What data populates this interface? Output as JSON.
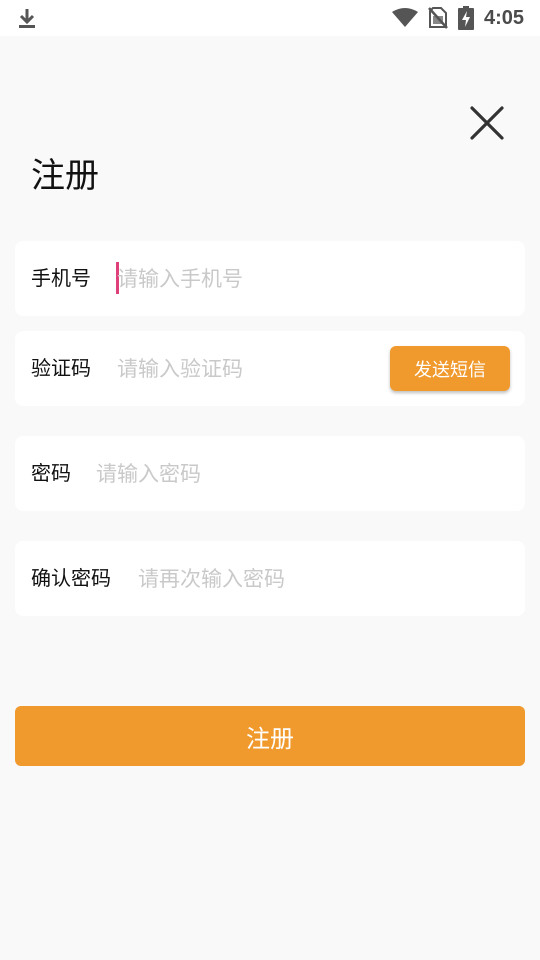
{
  "status_bar": {
    "time": "4:05",
    "icons": [
      "download-icon",
      "wifi-icon",
      "no-sim-icon",
      "battery-charging-icon"
    ]
  },
  "header": {
    "title": "注册",
    "close_icon": "close-icon"
  },
  "form": {
    "phone": {
      "label": "手机号",
      "placeholder": "请输入手机号",
      "value": ""
    },
    "code": {
      "label": "验证码",
      "placeholder": "请输入验证码",
      "value": "",
      "send_label": "发送短信"
    },
    "password": {
      "label": "密码",
      "placeholder": "请输入密码",
      "value": ""
    },
    "confirm": {
      "label": "确认密码",
      "placeholder": "请再次输入密码",
      "value": ""
    }
  },
  "actions": {
    "register_label": "注册"
  },
  "colors": {
    "accent": "#f09a2e",
    "caret": "#e0407a",
    "background": "#f9f9f9",
    "placeholder": "#c9c9c9"
  }
}
